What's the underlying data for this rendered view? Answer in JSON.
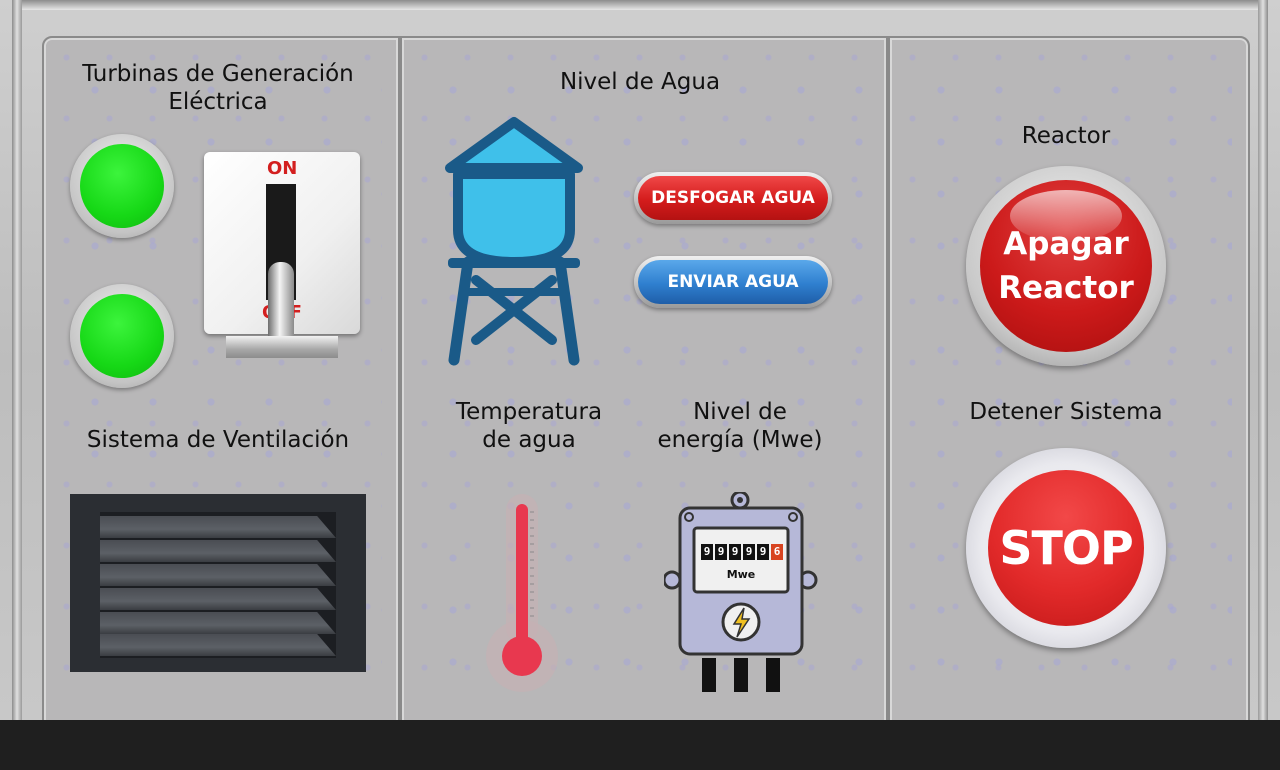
{
  "turbines": {
    "title": "Turbinas de Generación Eléctrica",
    "switch_on": "ON",
    "switch_off": "OFF"
  },
  "ventilation": {
    "title": "Sistema de Ventilación"
  },
  "water": {
    "title": "Nivel de Agua",
    "drain_button": "DESFOGAR AGUA",
    "send_button": "ENVIAR AGUA"
  },
  "temperature": {
    "title": "Temperatura de agua"
  },
  "energy": {
    "title": "Nivel de energía (Mwe)",
    "digits": [
      "9",
      "9",
      "9",
      "9",
      "9",
      "6"
    ],
    "unit": "Mwe"
  },
  "reactor": {
    "title": "Reactor",
    "button_line1": "Apagar",
    "button_line2": "Reactor"
  },
  "stop": {
    "title": "Detener Sistema",
    "button": "STOP"
  },
  "colors": {
    "lamp_green": "#16d816",
    "alert_red": "#d41c1c",
    "tower_blue": "#3fc0ea",
    "tower_outline": "#1a5a88"
  }
}
